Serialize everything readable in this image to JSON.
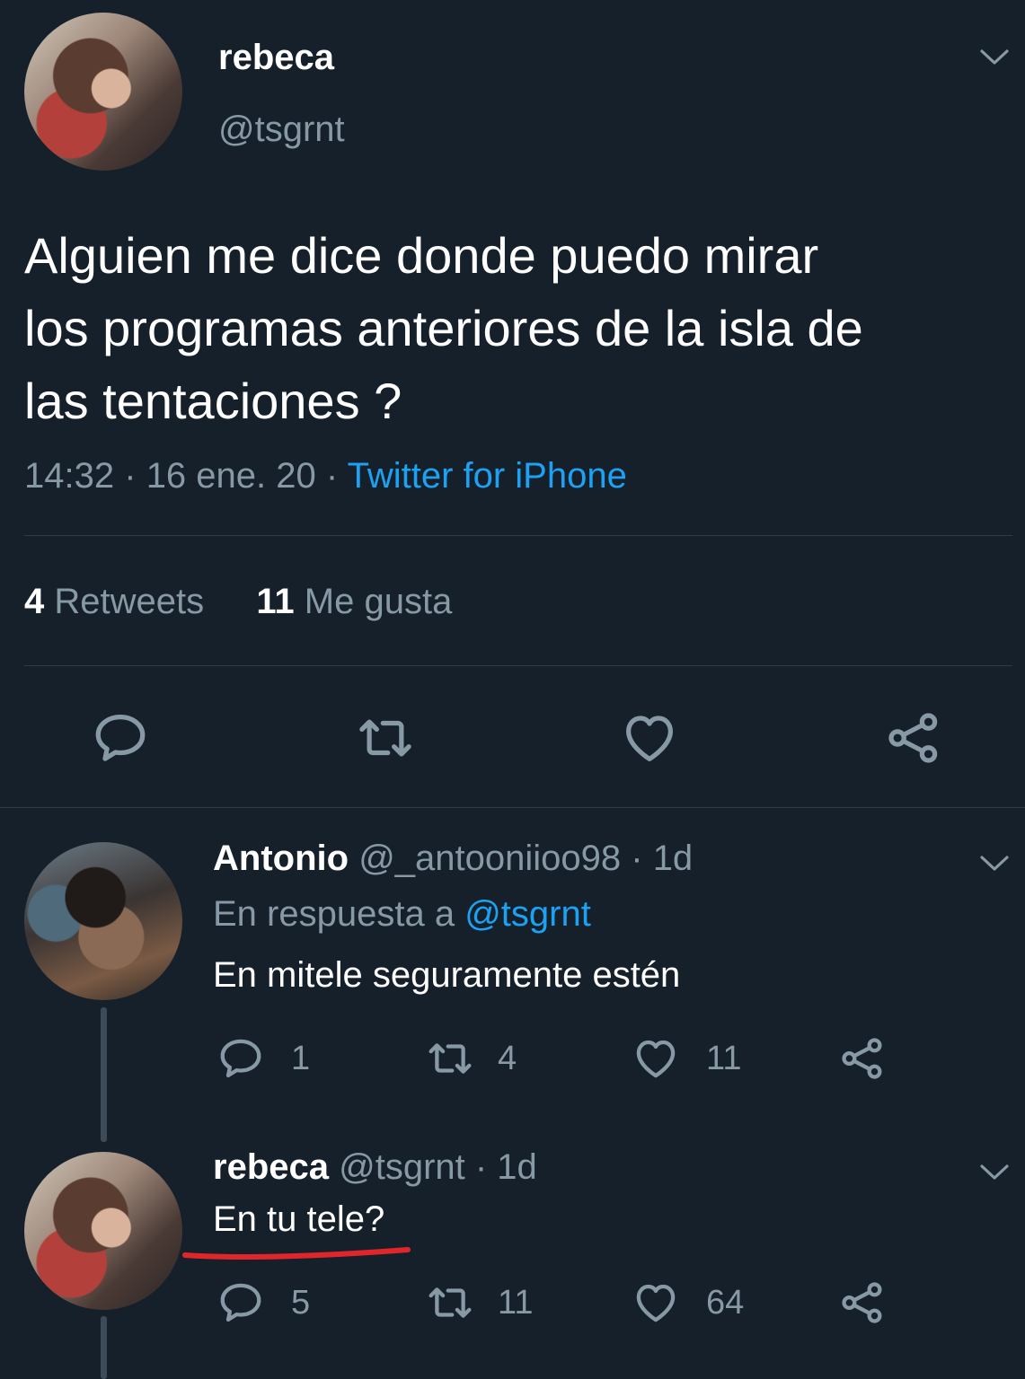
{
  "main_tweet": {
    "display_name": "rebeca",
    "handle": "@tsgrnt",
    "text_lines": [
      "Alguien me dice donde puedo mirar",
      "los programas anteriores de la isla de",
      "las tentaciones ?"
    ],
    "time": "14:32",
    "date": "16 ene. 20",
    "sep": "·",
    "source": "Twitter for iPhone",
    "retweets_count": "4",
    "retweets_label": "Retweets",
    "likes_count": "11",
    "likes_label": "Me gusta"
  },
  "replies": [
    {
      "display_name": "Antonio",
      "handle": "@_antooniioo98 · 1d",
      "reply_to_label": "En respuesta a",
      "reply_to_handle": "@tsgrnt",
      "text": "En mitele seguramente estén",
      "reply_count": "1",
      "retweet_count": "4",
      "like_count": "11"
    },
    {
      "display_name": "rebeca",
      "handle": "@tsgrnt · 1d",
      "text": "En tu tele?",
      "reply_count": "5",
      "retweet_count": "11",
      "like_count": "64"
    }
  ],
  "icons": {
    "reply": "speech-bubble-icon",
    "retweet": "retweet-icon",
    "like": "heart-icon",
    "share": "share-icon",
    "more": "chevron-down-icon"
  },
  "colors": {
    "background": "#15202b",
    "accent": "#1da1f2",
    "secondary_text": "#8899a6",
    "underline": "#e0262b"
  }
}
